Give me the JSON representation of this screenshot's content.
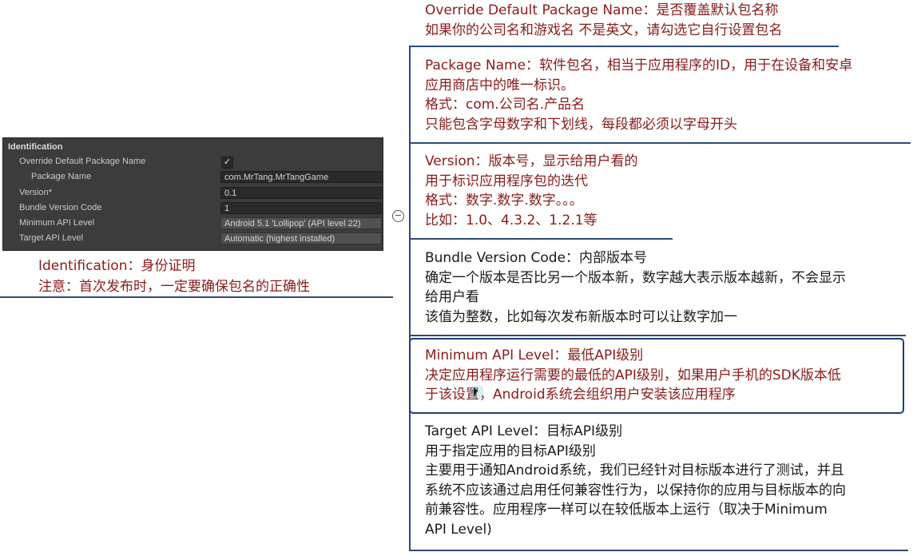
{
  "inspector": {
    "title": "Identification",
    "rows": [
      {
        "label": "Override Default Package Name",
        "value": "✓"
      },
      {
        "label": "Package Name",
        "value": "com.MrTang.MrTangGame"
      },
      {
        "label": "Version*",
        "value": "0.1"
      },
      {
        "label": "Bundle Version Code",
        "value": "1"
      },
      {
        "label": "Minimum API Level",
        "value": "Android 5.1 'Lollipop' (API level 22)"
      },
      {
        "label": "Target API Level",
        "value": "Automatic (highest installed)"
      }
    ]
  },
  "root": {
    "title": "Identification：身份证明",
    "note": "注意：首次发布时，一定要确保包名的正确性"
  },
  "nodes": [
    {
      "lines": [
        "Override Default Package Name：是否覆盖默认包名称",
        "如果你的公司名和游戏名 不是英文，请勾选它自行设置包名"
      ]
    },
    {
      "lines": [
        "Package Name：软件包名，相当于应用程序的ID，用于在设备和安卓",
        "应用商店中的唯一标识。",
        "格式：com.公司名.产品名",
        "只能包含字母数字和下划线，每段都必须以字母开头"
      ]
    },
    {
      "lines": [
        "Version：版本号，显示给用户看的",
        "用于标识应用程序包的迭代",
        "格式：数字.数字.数字。。。",
        "比如：1.0、4.3.2、1.2.1等"
      ]
    },
    {
      "lines": [
        "Bundle Version Code：内部版本号",
        "确定一个版本是否比另一个版本新，数字越大表示版本越新，不会显示",
        "给用户看",
        "该值为整数，比如每次发布新版本时可以让数字加一"
      ]
    },
    {
      "lines": [
        "Minimum API Level：最低API级别",
        "决定应用程序运行需要的最低的API级别，如果用户手机的SDK版本低",
        "于该设置，Android系统会组织用户安装该应用程序"
      ]
    },
    {
      "lines": [
        "Target API Level：目标API级别",
        "用于指定应用的目标API级别",
        "主要用于通知Android系统，我们已经针对目标版本进行了测试，并且",
        "系统不应该通过启用任何兼容性行为，以保持你的应用与目标版本的向",
        "前兼容性。应用程序一样可以在较低版本上运行（取决于Minimum",
        "API Level)"
      ]
    }
  ]
}
